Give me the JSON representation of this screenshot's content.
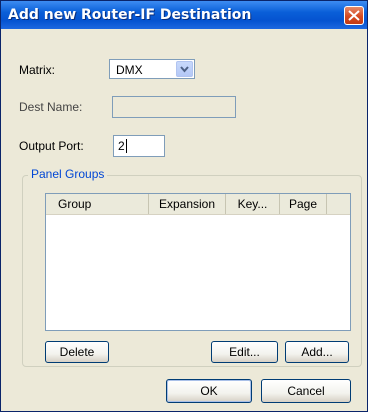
{
  "window": {
    "title": "Add new Router-IF Destination"
  },
  "form": {
    "matrix_label": "Matrix:",
    "matrix_value": "DMX",
    "dest_name_label": "Dest Name:",
    "dest_name_value": "",
    "output_port_label": "Output Port:",
    "output_port_value": "2"
  },
  "panel_groups": {
    "title": "Panel Groups",
    "columns": [
      "Group",
      "Expansion",
      "Key...",
      "Page"
    ],
    "rows": []
  },
  "buttons": {
    "delete": "Delete",
    "edit": "Edit...",
    "add": "Add...",
    "ok": "OK",
    "cancel": "Cancel"
  },
  "icons": {
    "close": "close-icon",
    "dropdown": "chevron-down-icon"
  },
  "colors": {
    "title_bar": "#0553d0",
    "close_button": "#d64a22",
    "dialog_bg": "#ece9d8",
    "group_title": "#0046d5"
  }
}
